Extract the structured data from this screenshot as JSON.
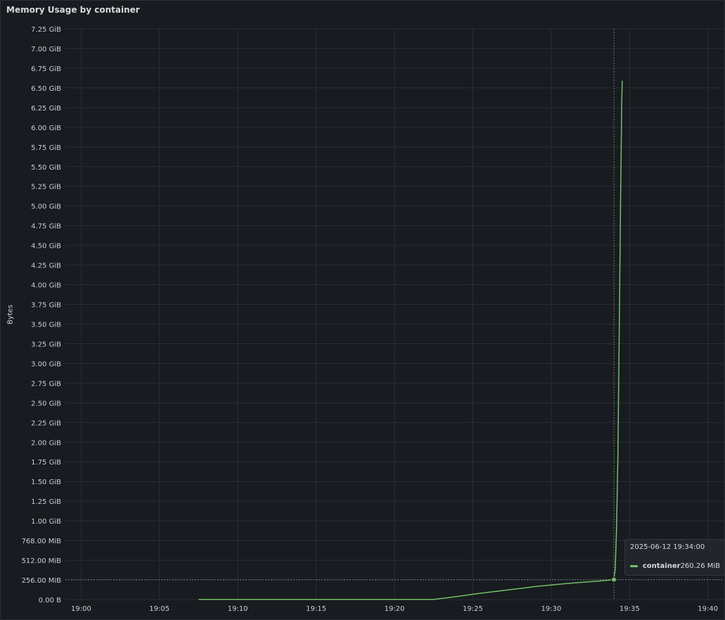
{
  "panel": {
    "title": "Memory Usage by container"
  },
  "colors": {
    "background": "#181b1f",
    "grid": "#2a2d33",
    "series": "#73bf69",
    "text": "#ccccdc"
  },
  "chart_data": {
    "type": "line",
    "title": "Memory Usage by container",
    "xlabel": "",
    "ylabel": "Bytes",
    "y_unit": "MiB",
    "ylim": [
      0,
      7424
    ],
    "y_ticks": [
      {
        "value": 0,
        "label": "0.00 B"
      },
      {
        "value": 256,
        "label": "256.00 MiB"
      },
      {
        "value": 512,
        "label": "512.00 MiB"
      },
      {
        "value": 768,
        "label": "768.00 MiB"
      },
      {
        "value": 1024,
        "label": "1.00 GiB"
      },
      {
        "value": 1280,
        "label": "1.25 GiB"
      },
      {
        "value": 1536,
        "label": "1.50 GiB"
      },
      {
        "value": 1792,
        "label": "1.75 GiB"
      },
      {
        "value": 2048,
        "label": "2.00 GiB"
      },
      {
        "value": 2304,
        "label": "2.25 GiB"
      },
      {
        "value": 2560,
        "label": "2.50 GiB"
      },
      {
        "value": 2816,
        "label": "2.75 GiB"
      },
      {
        "value": 3072,
        "label": "3.00 GiB"
      },
      {
        "value": 3328,
        "label": "3.25 GiB"
      },
      {
        "value": 3584,
        "label": "3.50 GiB"
      },
      {
        "value": 3840,
        "label": "3.75 GiB"
      },
      {
        "value": 4096,
        "label": "4.00 GiB"
      },
      {
        "value": 4352,
        "label": "4.25 GiB"
      },
      {
        "value": 4608,
        "label": "4.50 GiB"
      },
      {
        "value": 4864,
        "label": "4.75 GiB"
      },
      {
        "value": 5120,
        "label": "5.00 GiB"
      },
      {
        "value": 5376,
        "label": "5.25 GiB"
      },
      {
        "value": 5632,
        "label": "5.50 GiB"
      },
      {
        "value": 5888,
        "label": "5.75 GiB"
      },
      {
        "value": 6144,
        "label": "6.00 GiB"
      },
      {
        "value": 6400,
        "label": "6.25 GiB"
      },
      {
        "value": 6656,
        "label": "6.50 GiB"
      },
      {
        "value": 6912,
        "label": "6.75 GiB"
      },
      {
        "value": 7168,
        "label": "7.00 GiB"
      },
      {
        "value": 7424,
        "label": "7.25 GiB"
      }
    ],
    "xlim": [
      "2025-06-12 18:59:00",
      "2025-06-12 19:41:00"
    ],
    "x_ticks": [
      {
        "value": "2025-06-12 19:00:00",
        "label": "19:00"
      },
      {
        "value": "2025-06-12 19:05:00",
        "label": "19:05"
      },
      {
        "value": "2025-06-12 19:10:00",
        "label": "19:10"
      },
      {
        "value": "2025-06-12 19:15:00",
        "label": "19:15"
      },
      {
        "value": "2025-06-12 19:20:00",
        "label": "19:20"
      },
      {
        "value": "2025-06-12 19:25:00",
        "label": "19:25"
      },
      {
        "value": "2025-06-12 19:30:00",
        "label": "19:30"
      },
      {
        "value": "2025-06-12 19:35:00",
        "label": "19:35"
      },
      {
        "value": "2025-06-12 19:40:00",
        "label": "19:40"
      }
    ],
    "grid": true,
    "series": [
      {
        "name": "container",
        "color": "#73bf69",
        "points": [
          [
            "2025-06-12 19:07:30",
            2
          ],
          [
            "2025-06-12 19:10:00",
            2
          ],
          [
            "2025-06-12 19:15:00",
            2
          ],
          [
            "2025-06-12 19:20:00",
            2
          ],
          [
            "2025-06-12 19:22:30",
            3
          ],
          [
            "2025-06-12 19:23:00",
            15
          ],
          [
            "2025-06-12 19:24:00",
            40
          ],
          [
            "2025-06-12 19:25:00",
            70
          ],
          [
            "2025-06-12 19:26:00",
            95
          ],
          [
            "2025-06-12 19:27:00",
            120
          ],
          [
            "2025-06-12 19:28:00",
            145
          ],
          [
            "2025-06-12 19:29:00",
            170
          ],
          [
            "2025-06-12 19:30:00",
            190
          ],
          [
            "2025-06-12 19:31:00",
            210
          ],
          [
            "2025-06-12 19:32:00",
            225
          ],
          [
            "2025-06-12 19:33:00",
            240
          ],
          [
            "2025-06-12 19:33:30",
            250
          ],
          [
            "2025-06-12 19:34:00",
            260.26
          ],
          [
            "2025-06-12 19:34:05",
            400
          ],
          [
            "2025-06-12 19:34:10",
            900
          ],
          [
            "2025-06-12 19:34:15",
            1800
          ],
          [
            "2025-06-12 19:34:20",
            3300
          ],
          [
            "2025-06-12 19:34:25",
            5000
          ],
          [
            "2025-06-12 19:34:30",
            6450
          ],
          [
            "2025-06-12 19:34:32",
            6750
          ]
        ]
      }
    ],
    "hover": {
      "time": "2025-06-12 19:34:00",
      "value": 260.26
    }
  },
  "tooltip": {
    "time": "2025-06-12 19:34:00",
    "series_name": "container",
    "value": "260.26 MiB"
  }
}
